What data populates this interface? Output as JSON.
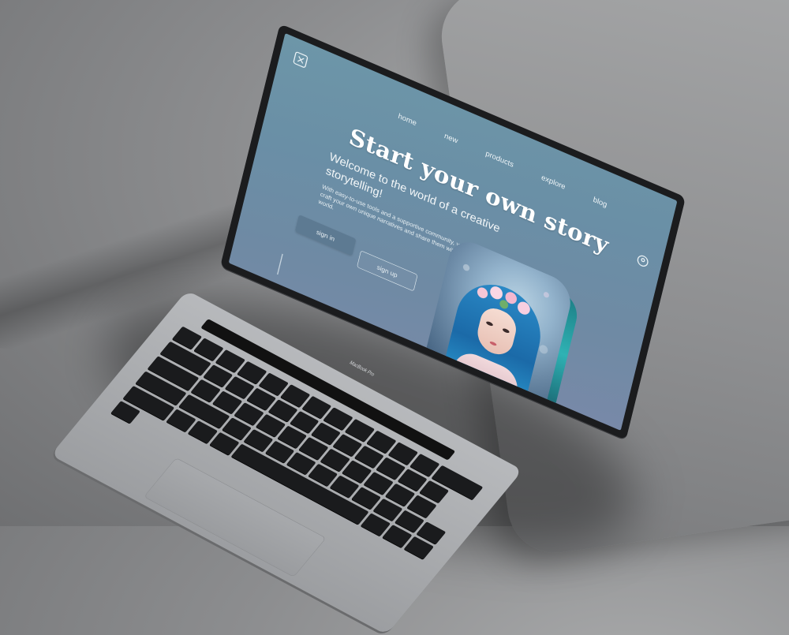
{
  "nav": {
    "items": [
      "home",
      "new",
      "products",
      "explore",
      "blog"
    ]
  },
  "hero": {
    "title": "Start your own story",
    "subtitle": "Welcome to the world of a creative storytelling!",
    "body": "With easy-to-use tools and a supportive community, you can craft your own unique narratives and share them with the world."
  },
  "buttons": {
    "sign_in": "sign in",
    "sign_up": "sign up"
  },
  "device": {
    "label": "MacBook Pro"
  },
  "icons": {
    "logo": "logo-icon",
    "user": "user-icon"
  },
  "colors": {
    "screen_bg": "#6d96a8",
    "button_fill": "#5d7a92",
    "text": "#ffffff"
  }
}
